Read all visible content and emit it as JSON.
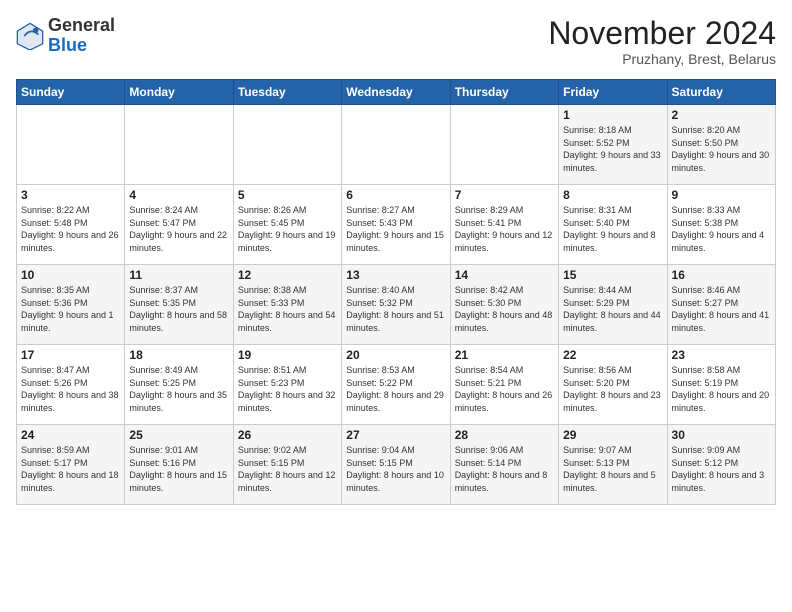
{
  "header": {
    "logo_general": "General",
    "logo_blue": "Blue",
    "month_title": "November 2024",
    "subtitle": "Pruzhany, Brest, Belarus"
  },
  "days_of_week": [
    "Sunday",
    "Monday",
    "Tuesday",
    "Wednesday",
    "Thursday",
    "Friday",
    "Saturday"
  ],
  "weeks": [
    [
      {
        "day": "",
        "info": ""
      },
      {
        "day": "",
        "info": ""
      },
      {
        "day": "",
        "info": ""
      },
      {
        "day": "",
        "info": ""
      },
      {
        "day": "",
        "info": ""
      },
      {
        "day": "1",
        "info": "Sunrise: 8:18 AM\nSunset: 5:52 PM\nDaylight: 9 hours and 33 minutes."
      },
      {
        "day": "2",
        "info": "Sunrise: 8:20 AM\nSunset: 5:50 PM\nDaylight: 9 hours and 30 minutes."
      }
    ],
    [
      {
        "day": "3",
        "info": "Sunrise: 8:22 AM\nSunset: 5:48 PM\nDaylight: 9 hours and 26 minutes."
      },
      {
        "day": "4",
        "info": "Sunrise: 8:24 AM\nSunset: 5:47 PM\nDaylight: 9 hours and 22 minutes."
      },
      {
        "day": "5",
        "info": "Sunrise: 8:26 AM\nSunset: 5:45 PM\nDaylight: 9 hours and 19 minutes."
      },
      {
        "day": "6",
        "info": "Sunrise: 8:27 AM\nSunset: 5:43 PM\nDaylight: 9 hours and 15 minutes."
      },
      {
        "day": "7",
        "info": "Sunrise: 8:29 AM\nSunset: 5:41 PM\nDaylight: 9 hours and 12 minutes."
      },
      {
        "day": "8",
        "info": "Sunrise: 8:31 AM\nSunset: 5:40 PM\nDaylight: 9 hours and 8 minutes."
      },
      {
        "day": "9",
        "info": "Sunrise: 8:33 AM\nSunset: 5:38 PM\nDaylight: 9 hours and 4 minutes."
      }
    ],
    [
      {
        "day": "10",
        "info": "Sunrise: 8:35 AM\nSunset: 5:36 PM\nDaylight: 9 hours and 1 minute."
      },
      {
        "day": "11",
        "info": "Sunrise: 8:37 AM\nSunset: 5:35 PM\nDaylight: 8 hours and 58 minutes."
      },
      {
        "day": "12",
        "info": "Sunrise: 8:38 AM\nSunset: 5:33 PM\nDaylight: 8 hours and 54 minutes."
      },
      {
        "day": "13",
        "info": "Sunrise: 8:40 AM\nSunset: 5:32 PM\nDaylight: 8 hours and 51 minutes."
      },
      {
        "day": "14",
        "info": "Sunrise: 8:42 AM\nSunset: 5:30 PM\nDaylight: 8 hours and 48 minutes."
      },
      {
        "day": "15",
        "info": "Sunrise: 8:44 AM\nSunset: 5:29 PM\nDaylight: 8 hours and 44 minutes."
      },
      {
        "day": "16",
        "info": "Sunrise: 8:46 AM\nSunset: 5:27 PM\nDaylight: 8 hours and 41 minutes."
      }
    ],
    [
      {
        "day": "17",
        "info": "Sunrise: 8:47 AM\nSunset: 5:26 PM\nDaylight: 8 hours and 38 minutes."
      },
      {
        "day": "18",
        "info": "Sunrise: 8:49 AM\nSunset: 5:25 PM\nDaylight: 8 hours and 35 minutes."
      },
      {
        "day": "19",
        "info": "Sunrise: 8:51 AM\nSunset: 5:23 PM\nDaylight: 8 hours and 32 minutes."
      },
      {
        "day": "20",
        "info": "Sunrise: 8:53 AM\nSunset: 5:22 PM\nDaylight: 8 hours and 29 minutes."
      },
      {
        "day": "21",
        "info": "Sunrise: 8:54 AM\nSunset: 5:21 PM\nDaylight: 8 hours and 26 minutes."
      },
      {
        "day": "22",
        "info": "Sunrise: 8:56 AM\nSunset: 5:20 PM\nDaylight: 8 hours and 23 minutes."
      },
      {
        "day": "23",
        "info": "Sunrise: 8:58 AM\nSunset: 5:19 PM\nDaylight: 8 hours and 20 minutes."
      }
    ],
    [
      {
        "day": "24",
        "info": "Sunrise: 8:59 AM\nSunset: 5:17 PM\nDaylight: 8 hours and 18 minutes."
      },
      {
        "day": "25",
        "info": "Sunrise: 9:01 AM\nSunset: 5:16 PM\nDaylight: 8 hours and 15 minutes."
      },
      {
        "day": "26",
        "info": "Sunrise: 9:02 AM\nSunset: 5:15 PM\nDaylight: 8 hours and 12 minutes."
      },
      {
        "day": "27",
        "info": "Sunrise: 9:04 AM\nSunset: 5:15 PM\nDaylight: 8 hours and 10 minutes."
      },
      {
        "day": "28",
        "info": "Sunrise: 9:06 AM\nSunset: 5:14 PM\nDaylight: 8 hours and 8 minutes."
      },
      {
        "day": "29",
        "info": "Sunrise: 9:07 AM\nSunset: 5:13 PM\nDaylight: 8 hours and 5 minutes."
      },
      {
        "day": "30",
        "info": "Sunrise: 9:09 AM\nSunset: 5:12 PM\nDaylight: 8 hours and 3 minutes."
      }
    ]
  ]
}
